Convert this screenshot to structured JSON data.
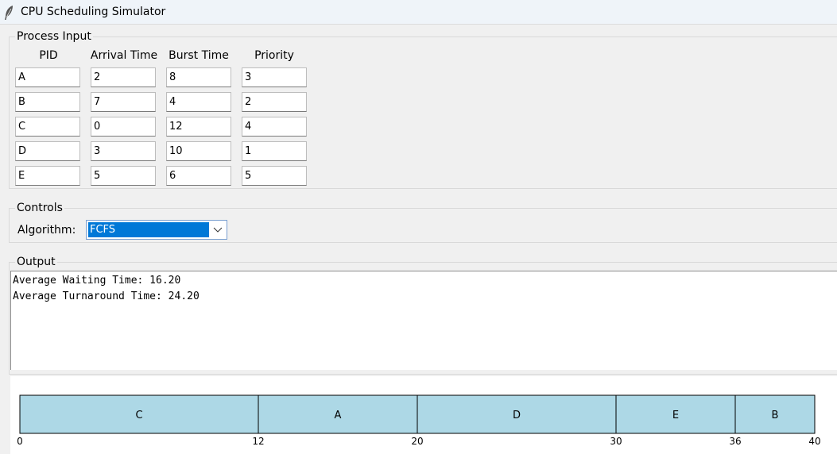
{
  "window": {
    "title": "CPU Scheduling Simulator"
  },
  "process_input": {
    "label": "Process Input",
    "headers": [
      "PID",
      "Arrival Time",
      "Burst Time",
      "Priority"
    ],
    "rows": [
      [
        "A",
        "2",
        "8",
        "3"
      ],
      [
        "B",
        "7",
        "4",
        "2"
      ],
      [
        "C",
        "0",
        "12",
        "4"
      ],
      [
        "D",
        "3",
        "10",
        "1"
      ],
      [
        "E",
        "5",
        "6",
        "5"
      ]
    ]
  },
  "controls": {
    "label": "Controls",
    "algorithm_label": "Algorithm:",
    "algorithm_value": "FCFS"
  },
  "output": {
    "label": "Output",
    "lines": [
      "Average Waiting Time: 16.20",
      "Average Turnaround Time: 24.20"
    ]
  },
  "gantt": {
    "total": 40,
    "fill": "#add8e6",
    "segments": [
      {
        "pid": "C",
        "start": 0,
        "end": 12
      },
      {
        "pid": "A",
        "start": 12,
        "end": 20
      },
      {
        "pid": "D",
        "start": 20,
        "end": 30
      },
      {
        "pid": "E",
        "start": 30,
        "end": 36
      },
      {
        "pid": "B",
        "start": 36,
        "end": 40
      }
    ],
    "ticks": [
      "0",
      "12",
      "20",
      "30",
      "36",
      "40"
    ]
  },
  "icons": {
    "app": "feather-icon",
    "dropdown": "chevron-down-icon"
  }
}
